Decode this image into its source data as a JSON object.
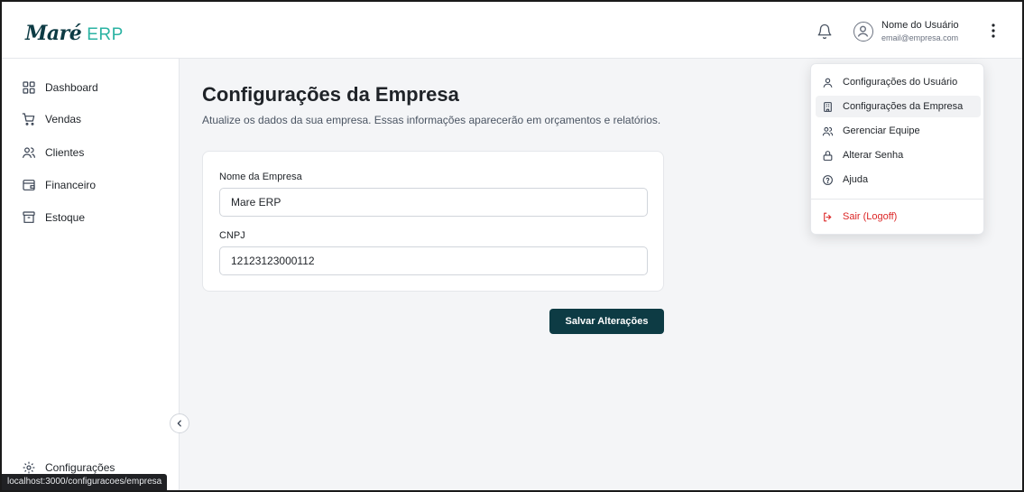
{
  "app": {
    "logo_mark": "Maré",
    "logo_text": "ERP"
  },
  "header": {
    "user_name": "Nome do Usuário",
    "user_email": "email@empresa.com",
    "icons": [
      "bell-icon",
      "user-avatar-icon",
      "more-vertical-icon"
    ]
  },
  "sidebar": {
    "items": [
      {
        "label": "Dashboard",
        "icon": "dashboard-icon"
      },
      {
        "label": "Vendas",
        "icon": "cart-icon"
      },
      {
        "label": "Clientes",
        "icon": "users-icon"
      },
      {
        "label": "Financeiro",
        "icon": "wallet-icon"
      },
      {
        "label": "Estoque",
        "icon": "archive-icon"
      }
    ],
    "settings_label": "Configurações",
    "collapse_icon": "chevron-left-icon"
  },
  "main": {
    "title": "Configurações da Empresa",
    "description": "Atualize os dados da sua empresa. Essas informações aparecerão em orçamentos e relatórios.",
    "fields": [
      {
        "label": "Nome da Empresa",
        "value": "Mare ERP"
      },
      {
        "label": "CNPJ",
        "value": "12123123000112"
      }
    ],
    "save_label": "Salvar Alterações"
  },
  "dropdown": {
    "items": [
      {
        "label": "Configurações do Usuário",
        "icon": "user-icon",
        "active": false
      },
      {
        "label": "Configurações da Empresa",
        "icon": "building-icon",
        "active": true
      },
      {
        "label": "Gerenciar Equipe",
        "icon": "team-icon",
        "active": false
      },
      {
        "label": "Alterar Senha",
        "icon": "lock-icon",
        "active": false
      },
      {
        "label": "Ajuda",
        "icon": "help-circle-icon",
        "active": false
      }
    ],
    "logout_label": "Sair (Logoff)"
  },
  "status_bar": {
    "url": "localhost:3000/configuracoes/empresa"
  },
  "colors": {
    "primary": "#0d3b44",
    "accent": "#2bb3a3",
    "danger": "#dc2626"
  }
}
